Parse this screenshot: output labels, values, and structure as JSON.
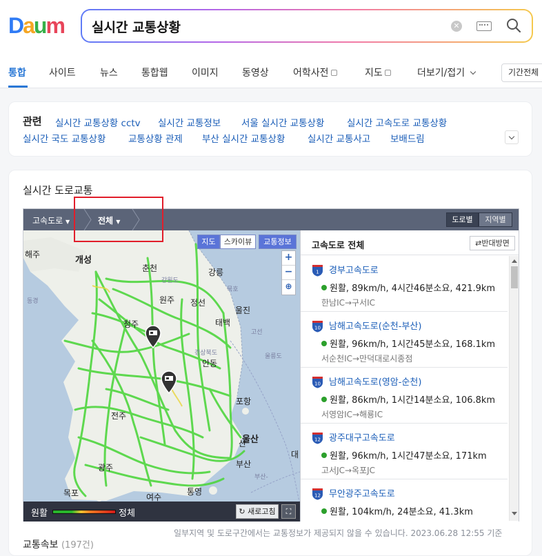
{
  "header": {
    "logo": [
      "D",
      "a",
      "u",
      "m"
    ],
    "search_value": "실시간 교통상황"
  },
  "tabs": [
    {
      "label": "통합",
      "active": true
    },
    {
      "label": "사이트"
    },
    {
      "label": "뉴스"
    },
    {
      "label": "통합웹"
    },
    {
      "label": "이미지"
    },
    {
      "label": "동영상"
    },
    {
      "label": "어학사전"
    },
    {
      "label": "지도"
    },
    {
      "label": "더보기/접기"
    }
  ],
  "period_label": "기간전체",
  "related": {
    "title": "관련",
    "links": [
      "실시간 교통상황 cctv",
      "실시간 교통정보",
      "서울 실시간 교통상황",
      "실시간 고속도로 교통상황",
      "실시간 국도 교통상황",
      "교통상황 관제",
      "부산 실시간 교통상황",
      "실시간 교통사고",
      "보배드림"
    ]
  },
  "traffic": {
    "title": "실시간 도로교통",
    "bar": {
      "category": "고속도로",
      "sub": "전체",
      "view_road": "도로별",
      "view_region": "지역별"
    },
    "map": {
      "btn_map": "지도",
      "btn_sky": "스카이뷰",
      "btn_traffic": "교통정보",
      "zoom_in": "+",
      "zoom_out": "−",
      "labels": [
        "해주",
        "개성",
        "춘천",
        "강릉",
        "원주",
        "정선",
        "태백",
        "울진",
        "청주",
        "안동",
        "포항",
        "전주",
        "울산",
        "광주",
        "부산",
        "목포",
        "여수",
        "통영",
        "산",
        "대"
      ],
      "tiny_labels": [
        "동경",
        "묵호",
        "강원도",
        "고선",
        "경상북도",
        "울릉도",
        "부산-"
      ],
      "legend_good": "원활",
      "legend_bad": "정체",
      "refresh": "새로고침"
    },
    "panel": {
      "title": "고속도로 전체",
      "reverse": "반대방면",
      "routes": [
        {
          "num": "1",
          "name": "경부고속도로",
          "status": "원활, 89km/h, 4시간46분소요, 421.9km",
          "segment": "한남IC→구서IC"
        },
        {
          "num": "10",
          "name": "남해고속도로(순천-부산)",
          "status": "원활, 96km/h, 1시간45분소요, 168.1km",
          "segment": "서순천IC→만덕대로시종점"
        },
        {
          "num": "10",
          "name": "남해고속도로(영암-순천)",
          "status": "원활, 86km/h, 1시간14분소요, 106.8km",
          "segment": "서영암IC→해룡IC"
        },
        {
          "num": "12",
          "name": "광주대구고속도로",
          "status": "원활, 96km/h, 1시간47분소요, 171km",
          "segment": "고서JC→옥포JC"
        },
        {
          "num": "12",
          "name": "무안광주고속도로",
          "status": "원활, 104km/h, 24분소요, 41.3km",
          "segment": ""
        }
      ]
    },
    "note": "일부지역 및 도로구간에서는 교통정보가 제공되지 않을 수 있습니다. 2023.06.28 12:55 기준"
  },
  "news": {
    "title": "교통속보",
    "count": "(197건)"
  }
}
